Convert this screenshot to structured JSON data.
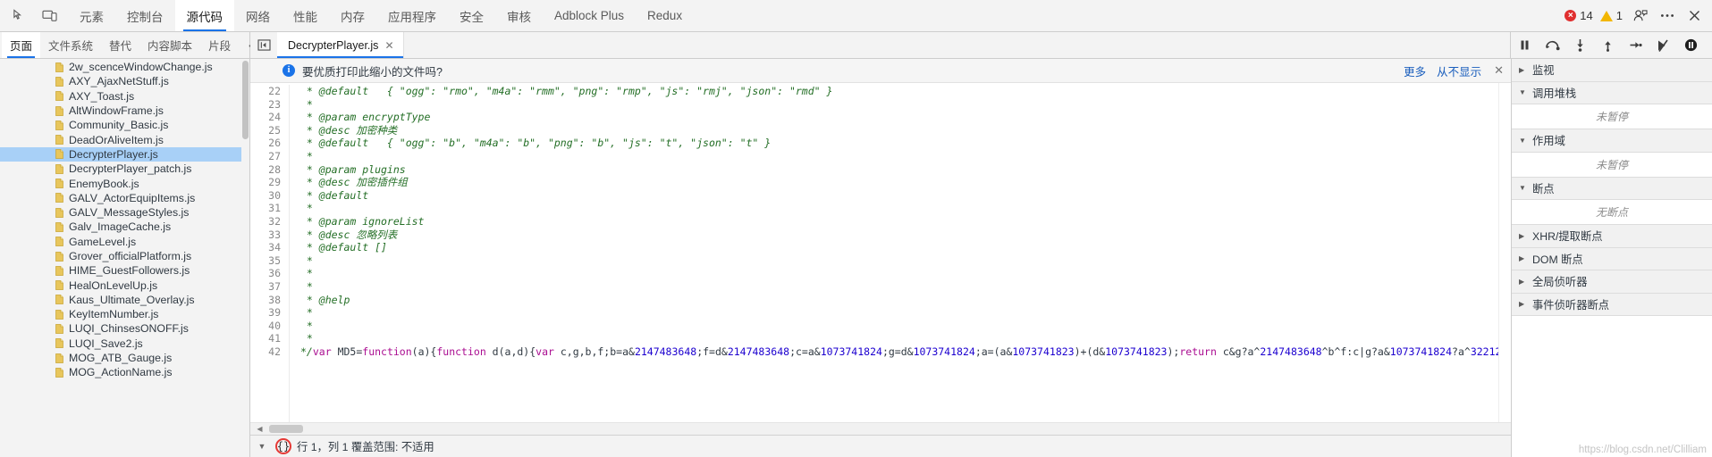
{
  "toolbar": {
    "inspect_icon": "cursor-inspect-icon",
    "device_icon": "device-toolbar-icon",
    "tabs": [
      {
        "label": "元素",
        "active": false
      },
      {
        "label": "控制台",
        "active": false
      },
      {
        "label": "源代码",
        "active": true
      },
      {
        "label": "网络",
        "active": false
      },
      {
        "label": "性能",
        "active": false
      },
      {
        "label": "内存",
        "active": false
      },
      {
        "label": "应用程序",
        "active": false
      },
      {
        "label": "安全",
        "active": false
      },
      {
        "label": "审核",
        "active": false
      },
      {
        "label": "Adblock Plus",
        "active": false
      },
      {
        "label": "Redux",
        "active": false
      }
    ],
    "error_count": "14",
    "warning_count": "1",
    "error_color": "#e02f2f",
    "warning_color": "#f2b600",
    "account_icon": "user-account-icon",
    "menu_icon": "kebab-menu-icon",
    "close_icon": "close-icon"
  },
  "nav_tabs": [
    {
      "label": "页面",
      "active": true
    },
    {
      "label": "文件系统",
      "active": false
    },
    {
      "label": "替代",
      "active": false
    },
    {
      "label": "内容脚本",
      "active": false
    },
    {
      "label": "片段",
      "active": false
    }
  ],
  "nav_more_label": "⋯",
  "panel_toggle_icon": "show-navigator-icon",
  "editor_tab": {
    "label": "DecrypterPlayer.js",
    "close_icon": "close-tab-icon"
  },
  "debug_controls": [
    {
      "name": "pause-resume-button",
      "icon": "pause-icon"
    },
    {
      "name": "step-over-button",
      "icon": "step-over-icon"
    },
    {
      "name": "step-into-button",
      "icon": "step-into-icon"
    },
    {
      "name": "step-out-button",
      "icon": "step-out-icon"
    },
    {
      "name": "step-button",
      "icon": "step-icon"
    },
    {
      "name": "deactivate-breakpoints-button",
      "icon": "deactivate-breakpoints-icon"
    },
    {
      "name": "pause-on-exceptions-button",
      "icon": "pause-on-exceptions-icon"
    }
  ],
  "file_tree": {
    "selected": "DecrypterPlayer.js",
    "files": [
      "2w_scenceWindowChange.js",
      "AXY_AjaxNetStuff.js",
      "AXY_Toast.js",
      "AltWindowFrame.js",
      "Community_Basic.js",
      "DeadOrAliveItem.js",
      "DecrypterPlayer.js",
      "DecrypterPlayer_patch.js",
      "EnemyBook.js",
      "GALV_ActorEquipItems.js",
      "GALV_MessageStyles.js",
      "Galv_ImageCache.js",
      "GameLevel.js",
      "Grover_officialPlatform.js",
      "HIME_GuestFollowers.js",
      "HealOnLevelUp.js",
      "Kaus_Ultimate_Overlay.js",
      "KeyItemNumber.js",
      "LUQI_ChinsesONOFF.js",
      "LUQI_Save2.js",
      "MOG_ATB_Gauge.js",
      "MOG_ActionName.js"
    ]
  },
  "info_bar": {
    "icon": "info-icon",
    "message": "要优质打印此缩小的文件吗?",
    "more_link": "更多",
    "never_show_link": "从不显示",
    "close_icon": "close-icon"
  },
  "code": {
    "first_line_number": 22,
    "lines": [
      {
        "n": 22,
        "parts": [
          {
            "t": " * @default   { \"ogg\": \"rmo\", \"m4a\": \"rmm\", \"png\": \"rmp\", \"js\": \"rmj\", \"json\": \"rmd\" }",
            "c": "cm"
          }
        ]
      },
      {
        "n": 23,
        "parts": [
          {
            "t": " *",
            "c": "cm"
          }
        ]
      },
      {
        "n": 24,
        "parts": [
          {
            "t": " * @param encryptType",
            "c": "cm"
          }
        ]
      },
      {
        "n": 25,
        "parts": [
          {
            "t": " * @desc 加密种类",
            "c": "cm"
          }
        ]
      },
      {
        "n": 26,
        "parts": [
          {
            "t": " * @default   { \"ogg\": \"b\", \"m4a\": \"b\", \"png\": \"b\", \"js\": \"t\", \"json\": \"t\" }",
            "c": "cm"
          }
        ]
      },
      {
        "n": 27,
        "parts": [
          {
            "t": " *",
            "c": "cm"
          }
        ]
      },
      {
        "n": 28,
        "parts": [
          {
            "t": " * @param plugins",
            "c": "cm"
          }
        ]
      },
      {
        "n": 29,
        "parts": [
          {
            "t": " * @desc 加密插件组",
            "c": "cm"
          }
        ]
      },
      {
        "n": 30,
        "parts": [
          {
            "t": " * @default",
            "c": "cm"
          }
        ]
      },
      {
        "n": 31,
        "parts": [
          {
            "t": " *",
            "c": "cm"
          }
        ]
      },
      {
        "n": 32,
        "parts": [
          {
            "t": " * @param ignoreList",
            "c": "cm"
          }
        ]
      },
      {
        "n": 33,
        "parts": [
          {
            "t": " * @desc 忽略列表",
            "c": "cm"
          }
        ]
      },
      {
        "n": 34,
        "parts": [
          {
            "t": " * @default []",
            "c": "cm"
          }
        ]
      },
      {
        "n": 35,
        "parts": [
          {
            "t": " *",
            "c": "cm"
          }
        ]
      },
      {
        "n": 36,
        "parts": [
          {
            "t": " *",
            "c": "cm"
          }
        ]
      },
      {
        "n": 37,
        "parts": [
          {
            "t": " *",
            "c": "cm"
          }
        ]
      },
      {
        "n": 38,
        "parts": [
          {
            "t": " * @help",
            "c": "cm"
          }
        ]
      },
      {
        "n": 39,
        "parts": [
          {
            "t": " *",
            "c": "cm"
          }
        ]
      },
      {
        "n": 40,
        "parts": [
          {
            "t": " *",
            "c": "cm"
          }
        ]
      },
      {
        "n": 41,
        "parts": [
          {
            "t": " *",
            "c": "cm"
          }
        ]
      },
      {
        "n": 42,
        "parts": [
          {
            "t": "*/",
            "c": "cm"
          },
          {
            "t": "var ",
            "c": "kw"
          },
          {
            "t": "MD5=",
            "c": "pl"
          },
          {
            "t": "function",
            "c": "kw"
          },
          {
            "t": "(a){",
            "c": "pl"
          },
          {
            "t": "function ",
            "c": "kw"
          },
          {
            "t": "d(a,d){",
            "c": "pl"
          },
          {
            "t": "var ",
            "c": "kw"
          },
          {
            "t": "c,g,b,f;b=a&",
            "c": "pl"
          },
          {
            "t": "2147483648",
            "c": "num"
          },
          {
            "t": ";f=d&",
            "c": "pl"
          },
          {
            "t": "2147483648",
            "c": "num"
          },
          {
            "t": ";c=a&",
            "c": "pl"
          },
          {
            "t": "1073741824",
            "c": "num"
          },
          {
            "t": ";g=d&",
            "c": "pl"
          },
          {
            "t": "1073741824",
            "c": "num"
          },
          {
            "t": ";a=(a&",
            "c": "pl"
          },
          {
            "t": "1073741823",
            "c": "num"
          },
          {
            "t": ")+(d&",
            "c": "pl"
          },
          {
            "t": "1073741823",
            "c": "num"
          },
          {
            "t": ");",
            "c": "pl"
          },
          {
            "t": "return ",
            "c": "kw"
          },
          {
            "t": "c&g?a^",
            "c": "pl"
          },
          {
            "t": "2147483648",
            "c": "num"
          },
          {
            "t": "^b^f:c",
            "c": "pl"
          },
          {
            "t": "|g?a&",
            "c": "pl"
          },
          {
            "t": "1073741824",
            "c": "num"
          },
          {
            "t": "?a^",
            "c": "pl"
          },
          {
            "t": "32212",
            "c": "num"
          }
        ]
      }
    ]
  },
  "hscroll": {
    "left_arrow": "scroll-left-arrow"
  },
  "status_bar": {
    "expand_icon": "expand-drawer-icon",
    "format_icon": "pretty-print-braces-icon",
    "format_icon_glyph": "{}",
    "position_text": "行 1，列 1  覆盖范围: 不适用",
    "watermark": "https://blog.csdn.net/Clilliam"
  },
  "debugger_pane": {
    "sections": [
      {
        "label": "监视",
        "expanded": false,
        "empty": null
      },
      {
        "label": "调用堆栈",
        "expanded": true,
        "empty": "未暂停"
      },
      {
        "label": "作用域",
        "expanded": true,
        "empty": "未暂停"
      },
      {
        "label": "断点",
        "expanded": true,
        "empty": "无断点"
      },
      {
        "label": "XHR/提取断点",
        "expanded": false,
        "empty": null
      },
      {
        "label": "DOM 断点",
        "expanded": false,
        "empty": null
      },
      {
        "label": "全局侦听器",
        "expanded": false,
        "empty": null
      },
      {
        "label": "事件侦听器断点",
        "expanded": false,
        "empty": null
      }
    ]
  }
}
